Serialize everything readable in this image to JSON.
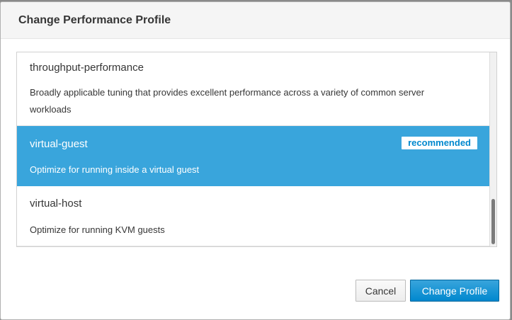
{
  "dialog": {
    "title": "Change Performance Profile"
  },
  "profiles": [
    {
      "name": "throughput-performance",
      "description": "Broadly applicable tuning that provides excellent performance across a variety of common server workloads",
      "badge": null,
      "selected": false
    },
    {
      "name": "virtual-guest",
      "description": "Optimize for running inside a virtual guest",
      "badge": "recommended",
      "selected": true
    },
    {
      "name": "virtual-host",
      "description": "Optimize for running KVM guests",
      "badge": null,
      "selected": false
    }
  ],
  "footer": {
    "cancel_label": "Cancel",
    "confirm_label": "Change Profile"
  },
  "colors": {
    "selected_bg": "#39a5dc",
    "primary_button": "#0088ce",
    "badge_text": "#0088ce"
  },
  "icons": {
    "scrollbar": "vertical-scrollbar"
  }
}
